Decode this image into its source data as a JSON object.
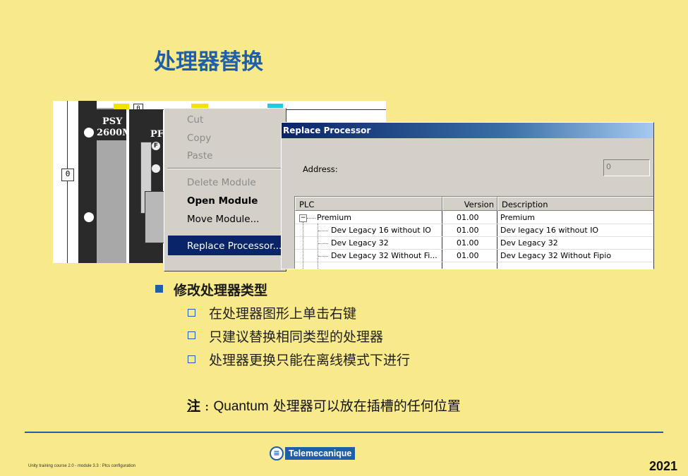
{
  "slide": {
    "title": "处理器替换"
  },
  "rack": {
    "module1_label_line1": "PSY",
    "module1_label_line2": "2600M",
    "module2_label": "PF",
    "module2_sub": "F",
    "slot_top_label": "0",
    "slot_side_label": "0"
  },
  "context_menu": {
    "items": [
      {
        "label": "Cut",
        "enabled": false
      },
      {
        "label": "Copy",
        "enabled": false
      },
      {
        "label": "Paste",
        "enabled": false
      },
      {
        "label": "Delete Module",
        "enabled": false
      },
      {
        "label": "Open Module",
        "enabled": true,
        "bold": true
      },
      {
        "label": "Move Module...",
        "enabled": true
      },
      {
        "label": "Replace Processor...",
        "enabled": true,
        "highlighted": true
      }
    ]
  },
  "dialog": {
    "title": "Replace Processor",
    "address_label": "Address:",
    "address_value": "0",
    "columns": [
      "PLC",
      "Version",
      "Description"
    ],
    "rows": [
      {
        "plc": "Premium",
        "version": "01.00",
        "description": "Premium",
        "level": 0
      },
      {
        "plc": "Dev Legacy 16 without IO",
        "version": "01.00",
        "description": "Dev legacy 16 without IO",
        "level": 1
      },
      {
        "plc": "Dev Legacy 32",
        "version": "01.00",
        "description": "Dev Legacy 32",
        "level": 1
      },
      {
        "plc": "Dev Legacy 32 Without Fi...",
        "version": "01.00",
        "description": "Dev Legacy 32 Without Fipio",
        "level": 1
      }
    ]
  },
  "bullets": {
    "heading": "修改处理器类型",
    "items": [
      "在处理器图形上单击右键",
      "只建议替换相同类型的处理器",
      "处理器更换只能在离线模式下进行"
    ]
  },
  "note": {
    "label": "注",
    "separator": " : ",
    "product": "Quantum",
    "text": " 处理器可以放在插槽的任何位置"
  },
  "footer": {
    "course": "Unity training course 2.0 - module 3.3 : Plcs configuration",
    "brand": "Telemecanique",
    "year": "2021"
  },
  "colors": {
    "background": "#F8E98A",
    "accent": "#1F5FA8",
    "selection": "#0A246A"
  },
  "icons": {
    "bullet_level1": "filled-square",
    "bullet_level2": "hollow-square",
    "tree_expander": "minus-box-icon",
    "brand_logo": "telemecanique-logo"
  }
}
